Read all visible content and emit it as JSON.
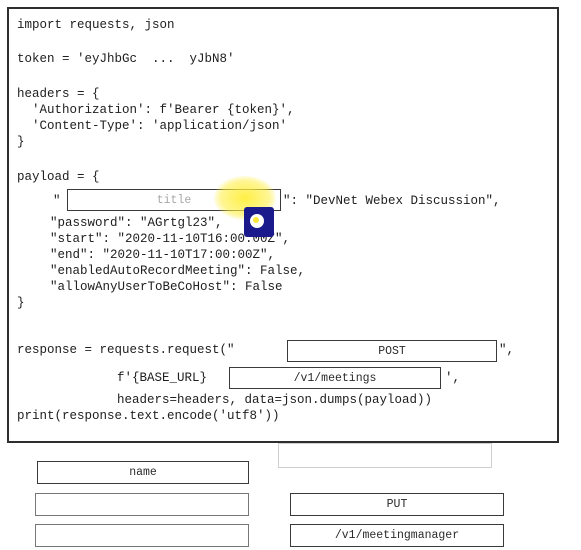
{
  "code": {
    "line1": "import requests, json",
    "line2": "token = 'eyJhbGc  ...  yJbN8'",
    "line3": "headers = {",
    "line4": "  'Authorization': f'Bearer {token}',",
    "line5": "  'Content-Type': 'application/json'",
    "line6": "}",
    "line7": "payload = {",
    "line8_prefix": "\"",
    "line8_suffix": "\": \"DevNet Webex Discussion\",",
    "line9": "  \"password\": \"AGrtgl23\",",
    "line10": "  \"start\": \"2020-11-10T16:00:00Z\",",
    "line11": "  \"end\": \"2020-11-10T17:00:00Z\",",
    "line12": "  \"enabledAutoRecordMeeting\": False,",
    "line13": "  \"allowAnyUserToBeCoHost\": False",
    "line14": "}",
    "line15_prefix": "response = requests.request(\"",
    "line15_suffix": "\",",
    "line16_prefix": "f'{BASE_URL}",
    "line16_suffix": "',",
    "line17": "headers=headers, data=json.dumps(payload))",
    "line18": "print(response.text.encode('utf8'))"
  },
  "slots": {
    "title_placeholder": "title",
    "method_value": "POST",
    "path_value": "/v1/meetings"
  },
  "options": {
    "name": "name",
    "put": "PUT",
    "meetingmanager": "/v1/meetingmanager"
  },
  "colors": {
    "cursor_highlight": "#ffee3c",
    "cursor_fill": "#1a1a8c"
  }
}
